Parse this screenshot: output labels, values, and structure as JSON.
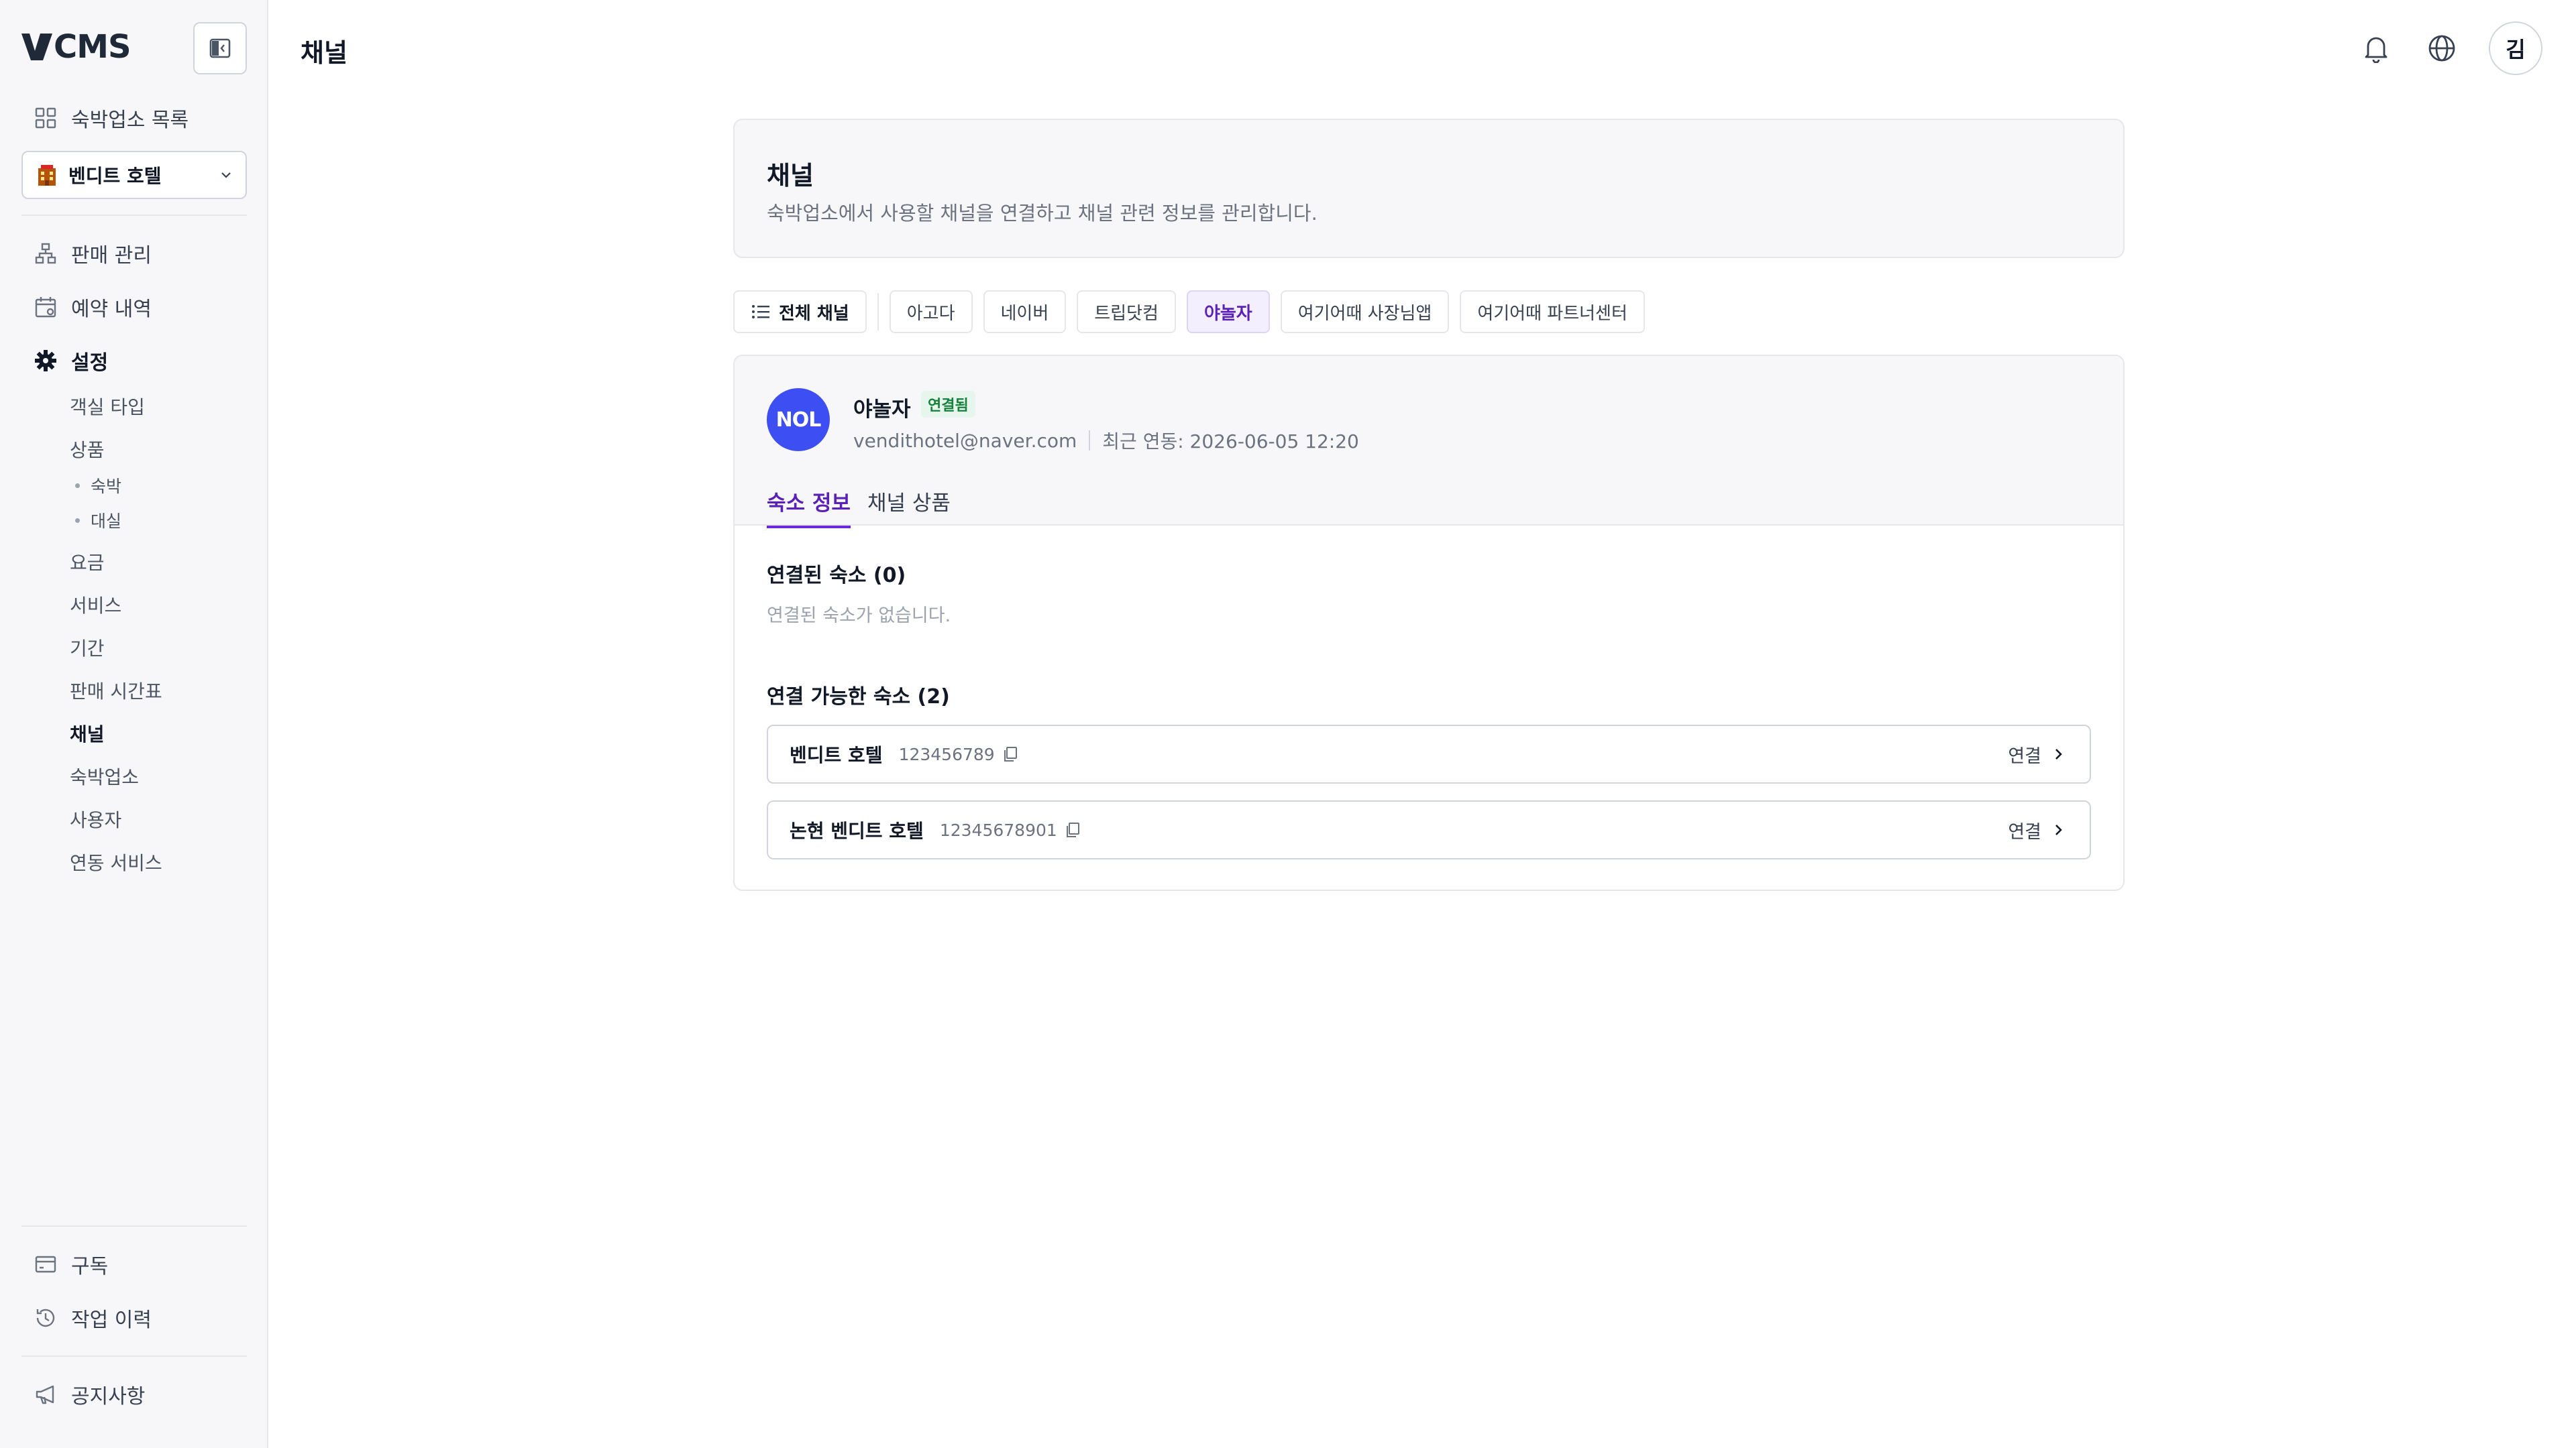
{
  "app": {
    "logo_text": "CMS"
  },
  "sidebar": {
    "property_list_label": "숙박업소 목록",
    "property_select": {
      "value": "벤디트 호텔"
    },
    "nav": {
      "sales": "판매 관리",
      "reservations": "예약 내역",
      "settings": "설정"
    },
    "settings_items": {
      "room_type": "객실 타입",
      "product": "상품",
      "product_stay": "숙박",
      "product_rental": "대실",
      "rate": "요금",
      "service": "서비스",
      "period": "기간",
      "sales_timetable": "판매 시간표",
      "channel": "채널",
      "property": "숙박업소",
      "users": "사용자",
      "integration": "연동 서비스"
    },
    "bottom": {
      "subscription": "구독",
      "job_history": "작업 이력",
      "notices": "공지사항"
    }
  },
  "header": {
    "title": "채널",
    "avatar_initial": "김"
  },
  "intro": {
    "title": "채널",
    "description": "숙박업소에서 사용할 채널을 연결하고 채널 관련 정보를 관리합니다."
  },
  "channel_filter": {
    "all_label": "전체 채널",
    "chips": [
      "아고다",
      "네이버",
      "트립닷컴",
      "야놀자",
      "여기어때 사장님앱",
      "여기어때 파트너센터"
    ],
    "selected": "야놀자"
  },
  "channel": {
    "logo_text": "NOL",
    "name": "야놀자",
    "status_badge": "연결됨",
    "email": "vendithotel@naver.com",
    "last_sync": "최근 연동: 2026-06-05 12:20",
    "tabs": {
      "property_info": "숙소 정보",
      "channel_products": "채널 상품"
    },
    "connected_section": {
      "title": "연결된 숙소 (0)",
      "empty_message": "연결된 숙소가 없습니다."
    },
    "available_section": {
      "title": "연결 가능한 숙소 (2)",
      "properties": [
        {
          "name": "벤디트 호텔",
          "id": "123456789",
          "action": "연결"
        },
        {
          "name": "논현 벤디트 호텔",
          "id": "12345678901",
          "action": "연결"
        }
      ]
    }
  },
  "colors": {
    "accent": "#6d28d9",
    "badge_green": "#16803c",
    "nol_blue": "#3d4ff2"
  }
}
